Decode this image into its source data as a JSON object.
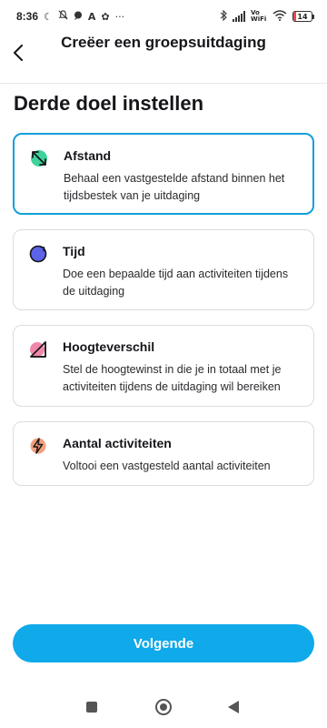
{
  "status_bar": {
    "time": "8:36",
    "volte": "Vo WiFi",
    "battery_level": "14",
    "battery_percent": 14
  },
  "header": {
    "back_icon": "chevron-left-icon",
    "title": "Creëer een groepsuitdaging"
  },
  "page_title": "Derde doel instellen",
  "options": [
    {
      "icon": "distance-arrows-icon",
      "title": "Afstand",
      "description": "Behaal een vastgestelde afstand binnen het tijdsbestek van je uitdaging",
      "selected": true
    },
    {
      "icon": "time-refresh-icon",
      "title": "Tijd",
      "description": "Doe een bepaalde tijd aan activiteiten tijdens de uitdaging",
      "selected": false
    },
    {
      "icon": "elevation-slope-icon",
      "title": "Hoogteverschil",
      "description": "Stel de hoogtewinst in die je in totaal met je activiteiten tijdens de uitdaging wil bereiken",
      "selected": false
    },
    {
      "icon": "lightning-bolt-icon",
      "title": "Aantal activiteiten",
      "description": "Voltooi een vastgesteld aantal activiteiten",
      "selected": false
    }
  ],
  "next_button": "Volgende",
  "colors": {
    "accent": "#10a9ea",
    "selected_border": "#149fd8",
    "distance_icon": "#3ed39a",
    "time_icon": "#5b63e8",
    "elevation_icon": "#ef7a9e",
    "activities_icon": "#f4a07c"
  }
}
